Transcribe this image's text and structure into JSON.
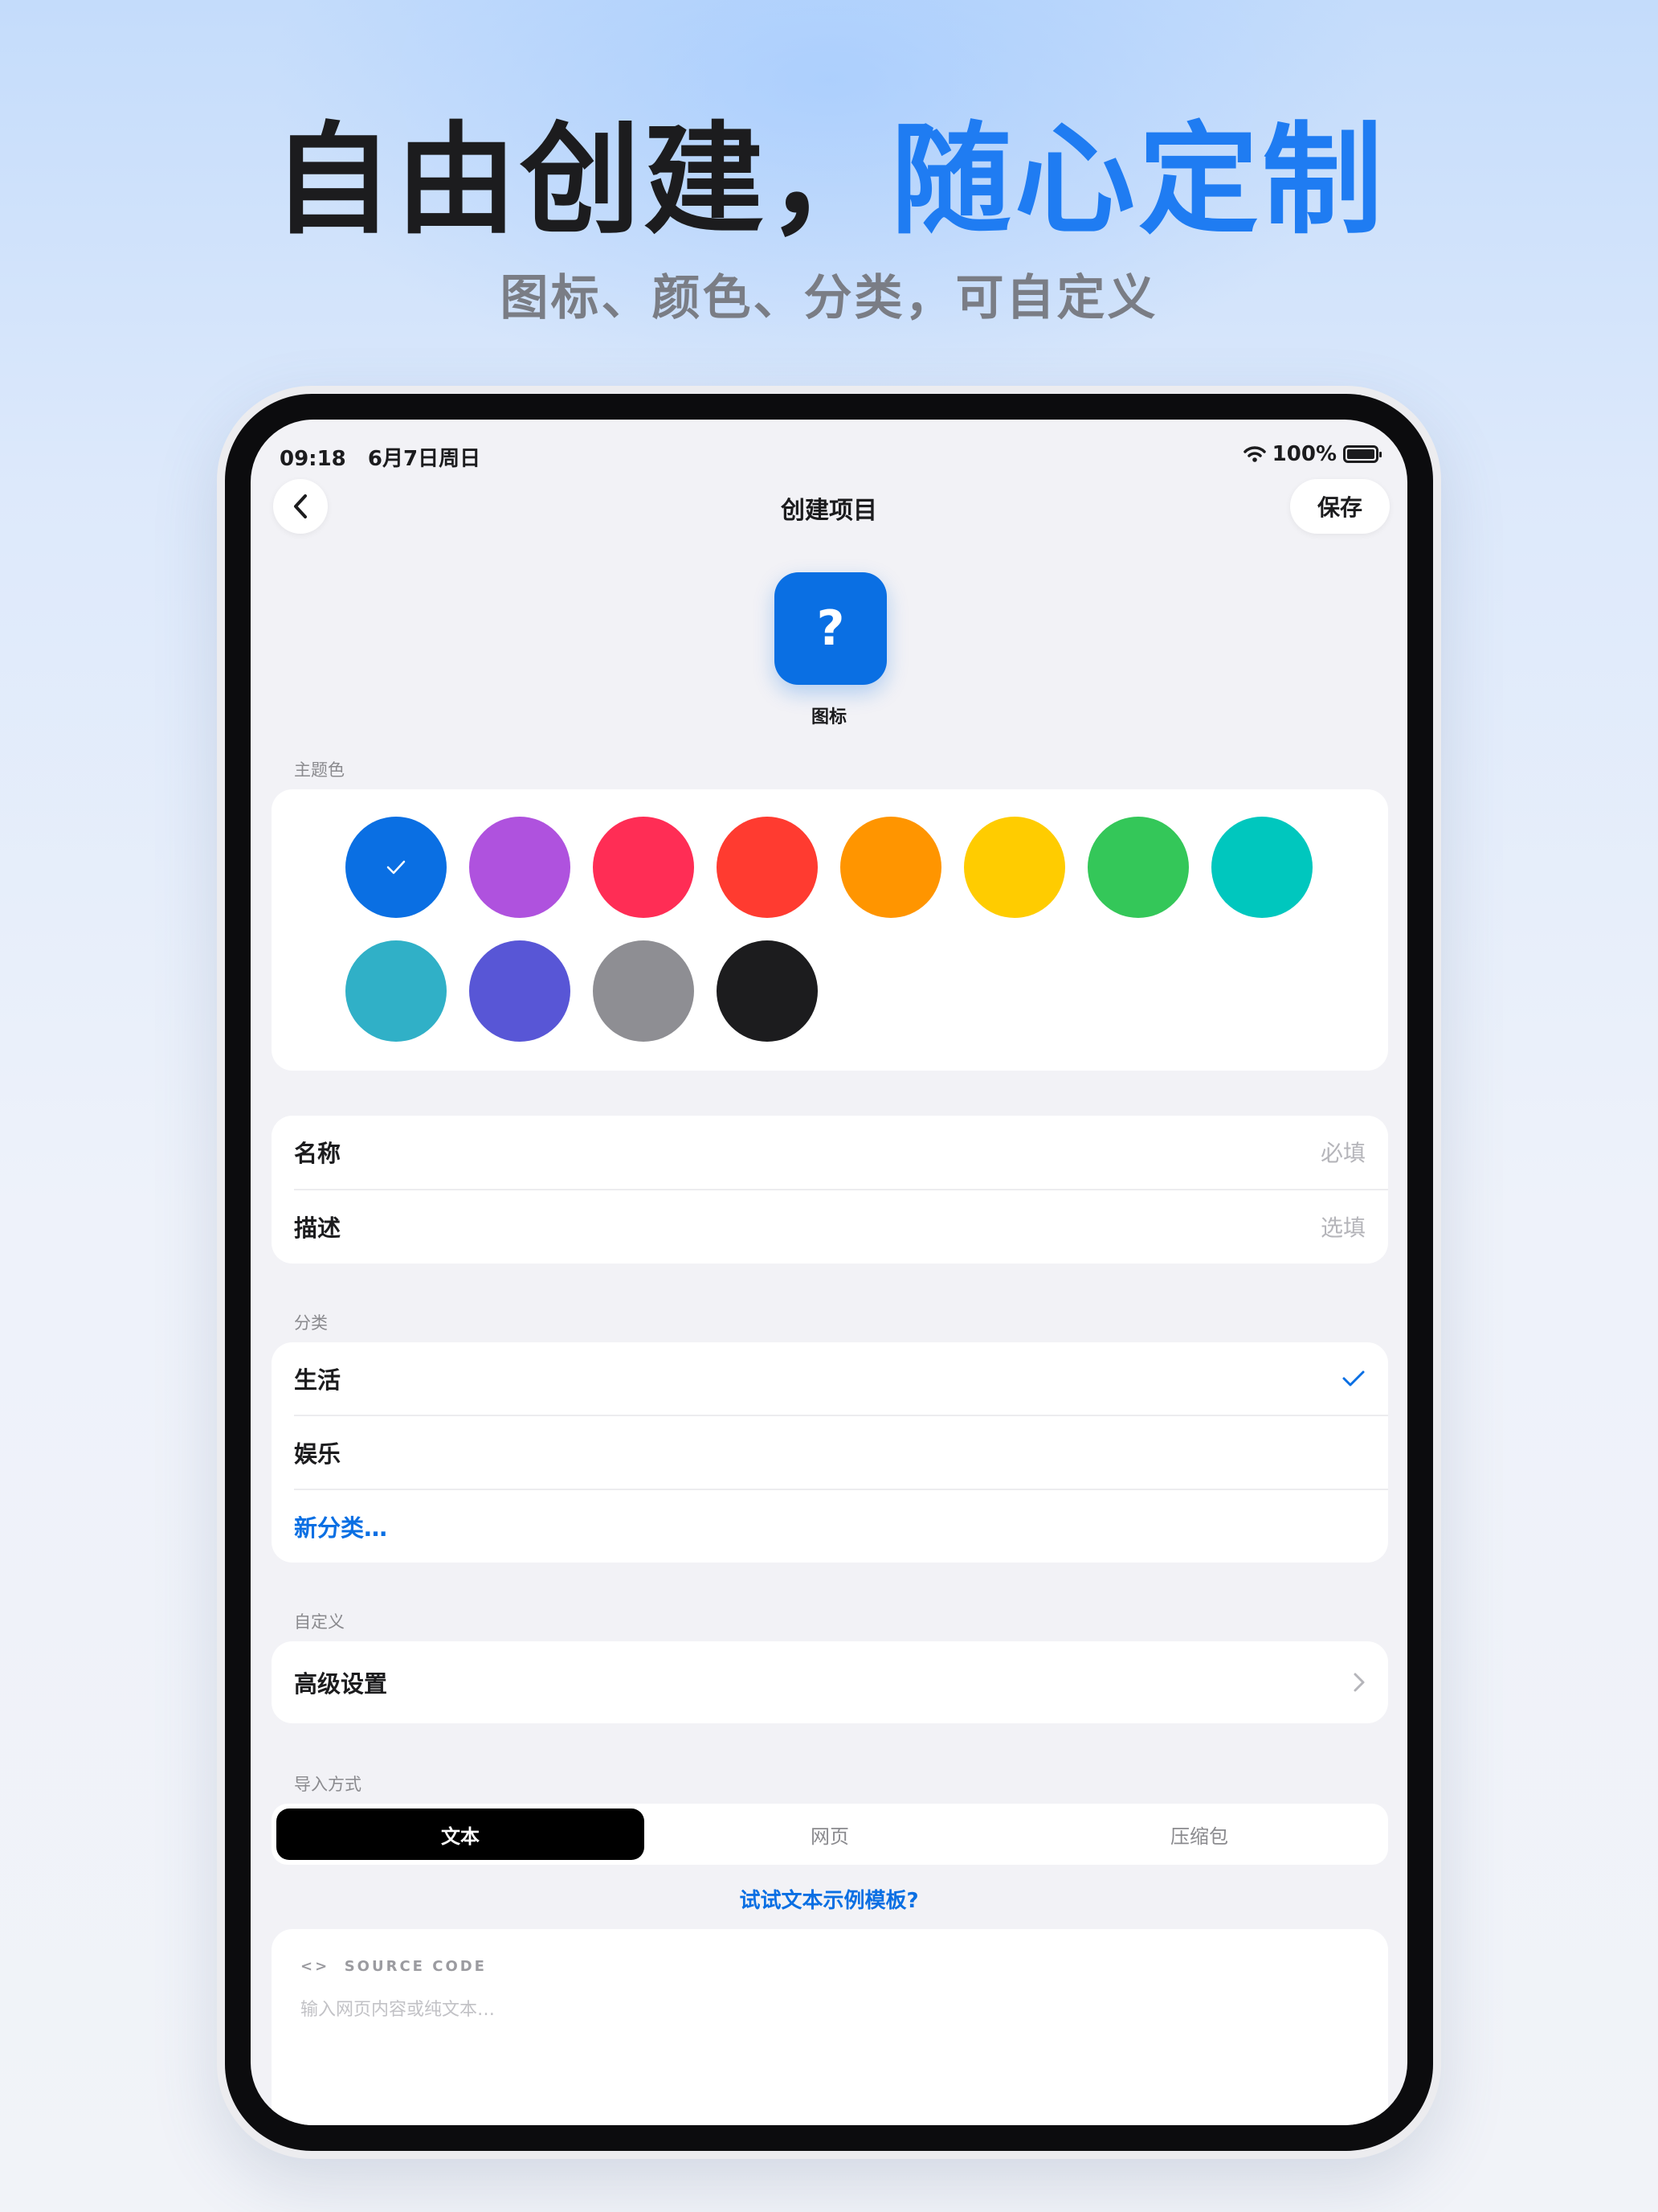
{
  "headline": {
    "part1": "自由创建，",
    "part2": "随心定制"
  },
  "subtitle": "图标、颜色、分类，可自定义",
  "status_bar": {
    "time": "09:18",
    "date": "6月7日周日",
    "battery": "100%"
  },
  "nav": {
    "title": "创建项目",
    "save_label": "保存"
  },
  "icon_label": "图标",
  "theme": {
    "label": "主题色",
    "selected": "#0A6FE3",
    "colors": [
      "#0A6FE3",
      "#AF52DE",
      "#FF2D55",
      "#FF3B30",
      "#FF9500",
      "#FFCC00",
      "#34C759",
      "#00C7BE",
      "#30B0C7",
      "#5856D6",
      "#8E8E93",
      "#1C1C1E"
    ]
  },
  "fields": {
    "name_label": "名称",
    "name_placeholder": "必填",
    "desc_label": "描述",
    "desc_placeholder": "选填"
  },
  "category": {
    "label": "分类",
    "items": [
      "生活",
      "娱乐"
    ],
    "selected": "生活",
    "new_label": "新分类…"
  },
  "custom": {
    "label": "自定义",
    "advanced": "高级设置"
  },
  "import": {
    "label": "导入方式",
    "tabs": [
      "文本",
      "网页",
      "压缩包"
    ],
    "active_tab": "文本",
    "template_link": "试试文本示例模板?"
  },
  "source": {
    "header": "SOURCE CODE",
    "placeholder": "输入网页内容或纯文本…"
  }
}
